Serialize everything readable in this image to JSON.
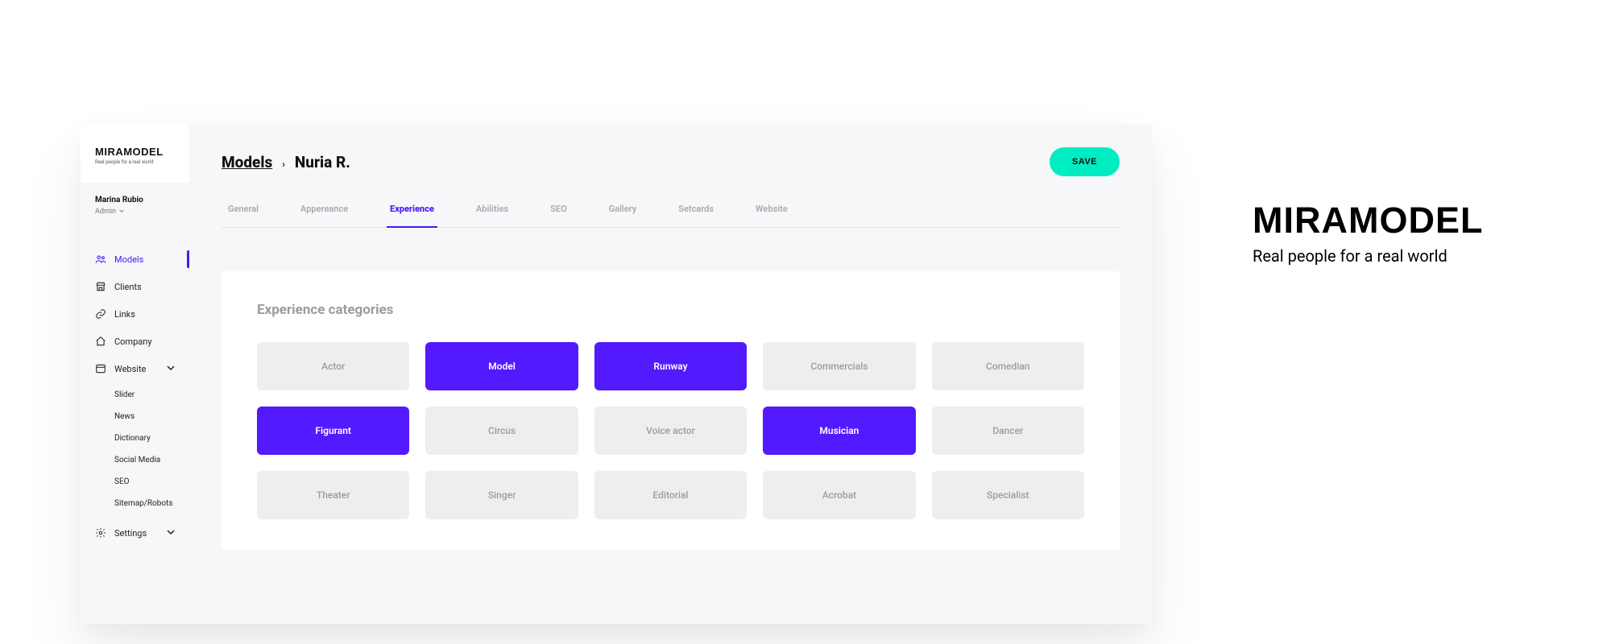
{
  "brand": {
    "name": "MIRAMODEL",
    "tagline": "Real people for a real world"
  },
  "sidebar": {
    "logo": {
      "name": "MIRAMODEL",
      "tagline": "Real people for a real world"
    },
    "user": {
      "name": "Marina Rubio",
      "role": "Admin"
    },
    "items": [
      {
        "id": "models",
        "label": "Models",
        "icon": "users-icon",
        "active": true,
        "expandable": false
      },
      {
        "id": "clients",
        "label": "Clients",
        "icon": "storefront-icon",
        "active": false,
        "expandable": false
      },
      {
        "id": "links",
        "label": "Links",
        "icon": "link-icon",
        "active": false,
        "expandable": false
      },
      {
        "id": "company",
        "label": "Company",
        "icon": "home-icon",
        "active": false,
        "expandable": false
      },
      {
        "id": "website",
        "label": "Website",
        "icon": "browser-icon",
        "active": false,
        "expandable": true,
        "expanded": true
      },
      {
        "id": "settings",
        "label": "Settings",
        "icon": "gear-icon",
        "active": false,
        "expandable": true,
        "expanded": false
      }
    ],
    "website_children": [
      {
        "label": "Slider"
      },
      {
        "label": "News"
      },
      {
        "label": "Dictionary"
      },
      {
        "label": "Social Media"
      },
      {
        "label": "SEO"
      },
      {
        "label": "Sitemap/Robots"
      }
    ]
  },
  "header": {
    "breadcrumb_root": "Models",
    "breadcrumb_sep": "›",
    "breadcrumb_leaf": "Nuria R.",
    "save_label": "SAVE"
  },
  "tabs": [
    {
      "label": "General",
      "active": false
    },
    {
      "label": "Appereance",
      "active": false
    },
    {
      "label": "Experience",
      "active": true
    },
    {
      "label": "Abilities",
      "active": false
    },
    {
      "label": "SEO",
      "active": false
    },
    {
      "label": "Gallery",
      "active": false
    },
    {
      "label": "Setcards",
      "active": false
    },
    {
      "label": "Website",
      "active": false
    }
  ],
  "panel": {
    "title": "Experience categories",
    "categories": [
      {
        "label": "Actor",
        "selected": false
      },
      {
        "label": "Model",
        "selected": true
      },
      {
        "label": "Runway",
        "selected": true
      },
      {
        "label": "Commercials",
        "selected": false
      },
      {
        "label": "Comedian",
        "selected": false
      },
      {
        "label": "Figurant",
        "selected": true
      },
      {
        "label": "Circus",
        "selected": false
      },
      {
        "label": "Voice actor",
        "selected": false
      },
      {
        "label": "Musician",
        "selected": true
      },
      {
        "label": "Dancer",
        "selected": false
      },
      {
        "label": "Theater",
        "selected": false
      },
      {
        "label": "Singer",
        "selected": false
      },
      {
        "label": "Editorial",
        "selected": false
      },
      {
        "label": "Acrobat",
        "selected": false
      },
      {
        "label": "Specialist",
        "selected": false
      }
    ]
  },
  "colors": {
    "accent": "#5319ff",
    "save": "#00ecc2"
  }
}
